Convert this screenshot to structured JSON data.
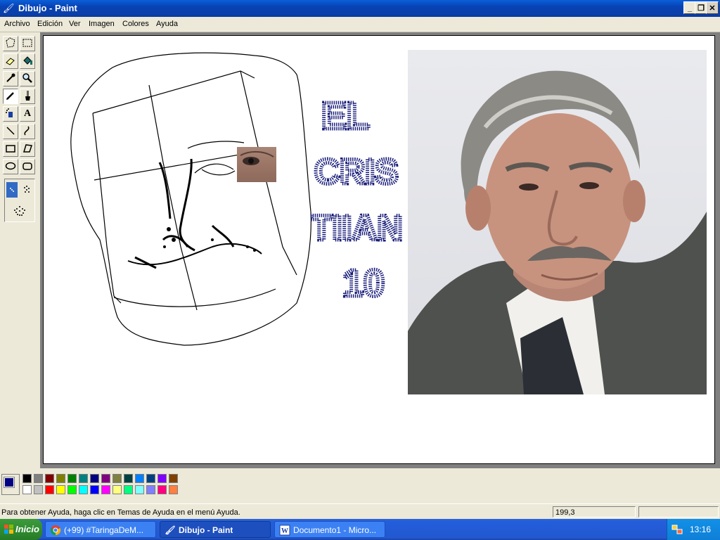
{
  "window": {
    "title": "Dibujo - Paint",
    "icon": "paint-brush-icon"
  },
  "menu": {
    "items": [
      "Archivo",
      "Edición",
      "Ver",
      "Imagen",
      "Colores",
      "Ayuda"
    ]
  },
  "tools": [
    "free-select-icon",
    "rect-select-icon",
    "eraser-icon",
    "fill-bucket-icon",
    "color-picker-icon",
    "magnifier-icon",
    "pencil-icon",
    "brush-icon",
    "airbrush-icon",
    "text-icon",
    "line-icon",
    "curve-icon",
    "rectangle-icon",
    "polygon-icon",
    "ellipse-icon",
    "rounded-rect-icon"
  ],
  "canvas": {
    "handwritten_text": [
      "EL",
      "CRIS",
      "TIIAN",
      "10"
    ],
    "ink_color": "#1b1f7a"
  },
  "palette": {
    "foreground": "#000080",
    "background": "#ffffff",
    "colors": [
      "#000000",
      "#808080",
      "#800000",
      "#808000",
      "#008000",
      "#008080",
      "#000080",
      "#800080",
      "#808040",
      "#004040",
      "#0080ff",
      "#004080",
      "#8000ff",
      "#804000",
      "#ffffff",
      "#c0c0c0",
      "#ff0000",
      "#ffff00",
      "#00ff00",
      "#00ffff",
      "#0000ff",
      "#ff00ff",
      "#ffff80",
      "#00ff80",
      "#80ffff",
      "#8080ff",
      "#ff0080",
      "#ff8040"
    ]
  },
  "status": {
    "message": "Para obtener Ayuda, haga clic en Temas de Ayuda en el menú Ayuda.",
    "coords": "199,3"
  },
  "taskbar": {
    "start": "Inicio",
    "tasks": [
      {
        "label": "(+99) #TaringaDeM...",
        "icon": "chrome-icon"
      },
      {
        "label": "Dibujo - Paint",
        "icon": "paint-brush-icon"
      },
      {
        "label": "Documento1 - Micro...",
        "icon": "word-icon"
      }
    ],
    "clock": "13:16"
  }
}
